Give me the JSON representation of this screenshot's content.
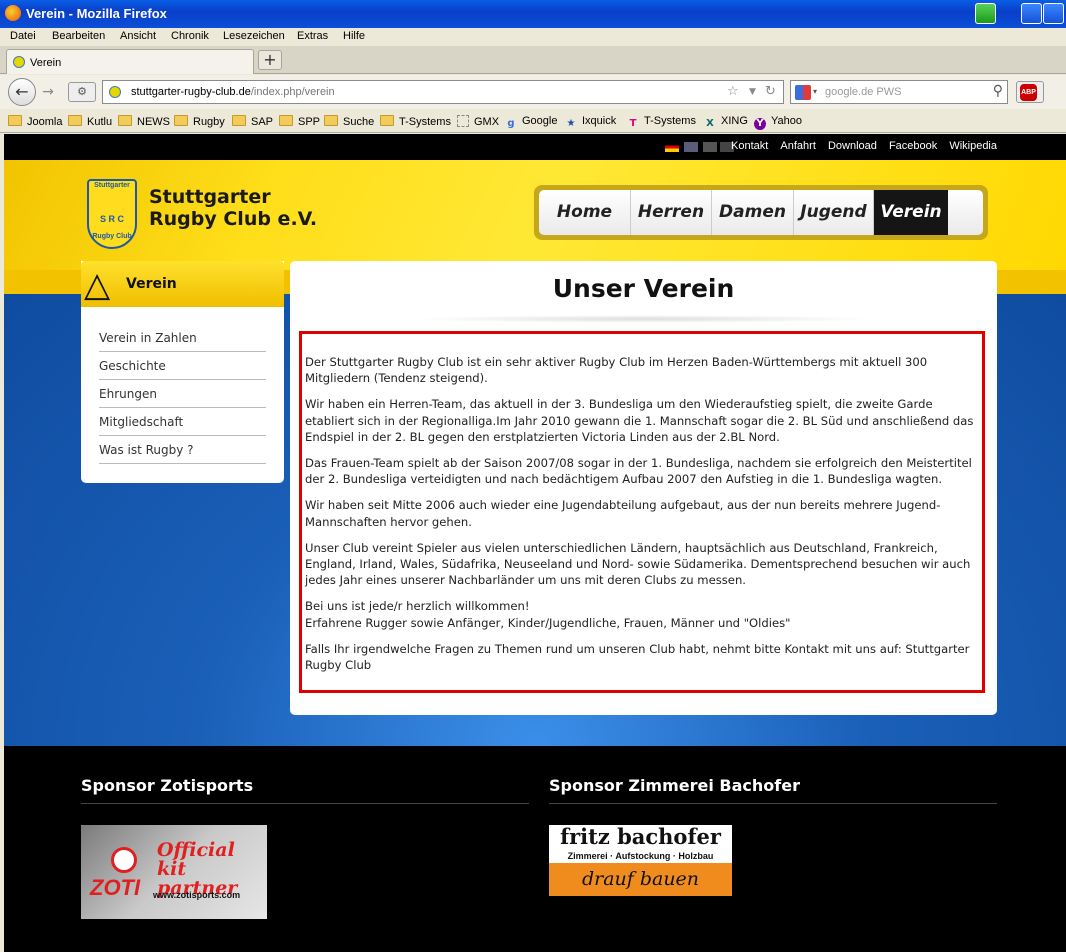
{
  "window": {
    "title": "Verein - Mozilla Firefox"
  },
  "menu": [
    "Datei",
    "Bearbeiten",
    "Ansicht",
    "Chronik",
    "Lesezeichen",
    "Extras",
    "Hilfe"
  ],
  "tab": {
    "label": "Verein",
    "new_tab_label": "+"
  },
  "nav": {
    "back_label": "←",
    "forward_label": "→",
    "url_host": "stuttgarter-rugby-club.de",
    "url_path": "/index.php/verein",
    "search_placeholder": "google.de PWS",
    "abp_label": "ABP"
  },
  "bookmarks": [
    "Joomla",
    "Kutlu",
    "NEWS",
    "Rugby",
    "SAP",
    "SPP",
    "Suche",
    "T-Systems",
    "GMX",
    "Google",
    "Ixquick",
    "T-Systems",
    "XING",
    "Yahoo"
  ],
  "site": {
    "top_links": [
      "Kontakt",
      "Anfahrt",
      "Download",
      "Facebook",
      "Wikipedia"
    ],
    "logo": {
      "top": "Stuttgarter",
      "mid": "S R C",
      "bottom": "Rugby Club"
    },
    "name_line1": "Stuttgarter",
    "name_line2": "Rugby Club e.V.",
    "main_nav": [
      {
        "label": "Home"
      },
      {
        "label": "Herren"
      },
      {
        "label": "Damen"
      },
      {
        "label": "Jugend"
      },
      {
        "label": "Verein",
        "active": true
      }
    ],
    "sidebar": {
      "title": "Verein",
      "items": [
        "Verein in Zahlen",
        "Geschichte",
        "Ehrungen",
        "Mitgliedschaft",
        "Was ist Rugby ?"
      ]
    },
    "main": {
      "title": "Unser Verein",
      "paragraphs": [
        "Der Stuttgarter Rugby Club ist ein sehr aktiver Rugby Club im Herzen Baden-Württembergs mit aktuell 300 Mitgliedern (Tendenz steigend).",
        "Wir haben ein Herren-Team, das aktuell in der 3. Bundesliga um den Wiederaufstieg spielt, die zweite Garde etabliert sich in der Regionalliga.Im Jahr 2010 gewann die 1. Mannschaft sogar die 2. BL Süd und anschließend das Endspiel in der 2. BL gegen den erstplatzierten Victoria Linden aus der 2.BL Nord.",
        "Das Frauen-Team spielt ab der Saison 2007/08 sogar in der 1. Bundesliga, nachdem sie erfolgreich den Meistertitel der 2. Bundesliga verteidigten und nach bedächtigem Aufbau 2007 den Aufstieg in die 1. Bundesliga wagten.",
        "Wir haben seit Mitte 2006 auch wieder eine Jugendabteilung aufgebaut, aus der nun bereits mehrere Jugend-Mannschaften hervor gehen.",
        "Unser Club vereint Spieler aus vielen unterschiedlichen Ländern, hauptsächlich aus Deutschland, Frankreich, England, Irland, Wales, Südafrika, Neuseeland und Nord- sowie Südamerika. Dementsprechend besuchen wir auch jedes Jahr eines unserer Nachbarländer um uns mit deren Clubs zu messen."
      ],
      "welcome_line1": "Bei uns ist jede/r herzlich willkommen!",
      "welcome_line2": "Erfahrene Rugger sowie Anfänger, Kinder/Jugendliche, Frauen, Männer und \"Oldies\"",
      "closing": "Falls Ihr irgendwelche Fragen zu Themen rund um unseren Club habt, nehmt bitte Kontakt mit uns auf: Stuttgarter Rugby Club"
    },
    "sponsors": [
      {
        "title": "Sponsor Zotisports",
        "banner_line1": "Official kit",
        "banner_line2": "partner",
        "banner_brand": "ZOTI",
        "banner_url": "www.zotisports.com"
      },
      {
        "title": "Sponsor Zimmerei Bachofer",
        "banner_line1": "fritz bachofer",
        "banner_line2": "Zimmerei · Aufstockung · Holzbau",
        "banner_line3": "drauf bauen"
      }
    ]
  }
}
